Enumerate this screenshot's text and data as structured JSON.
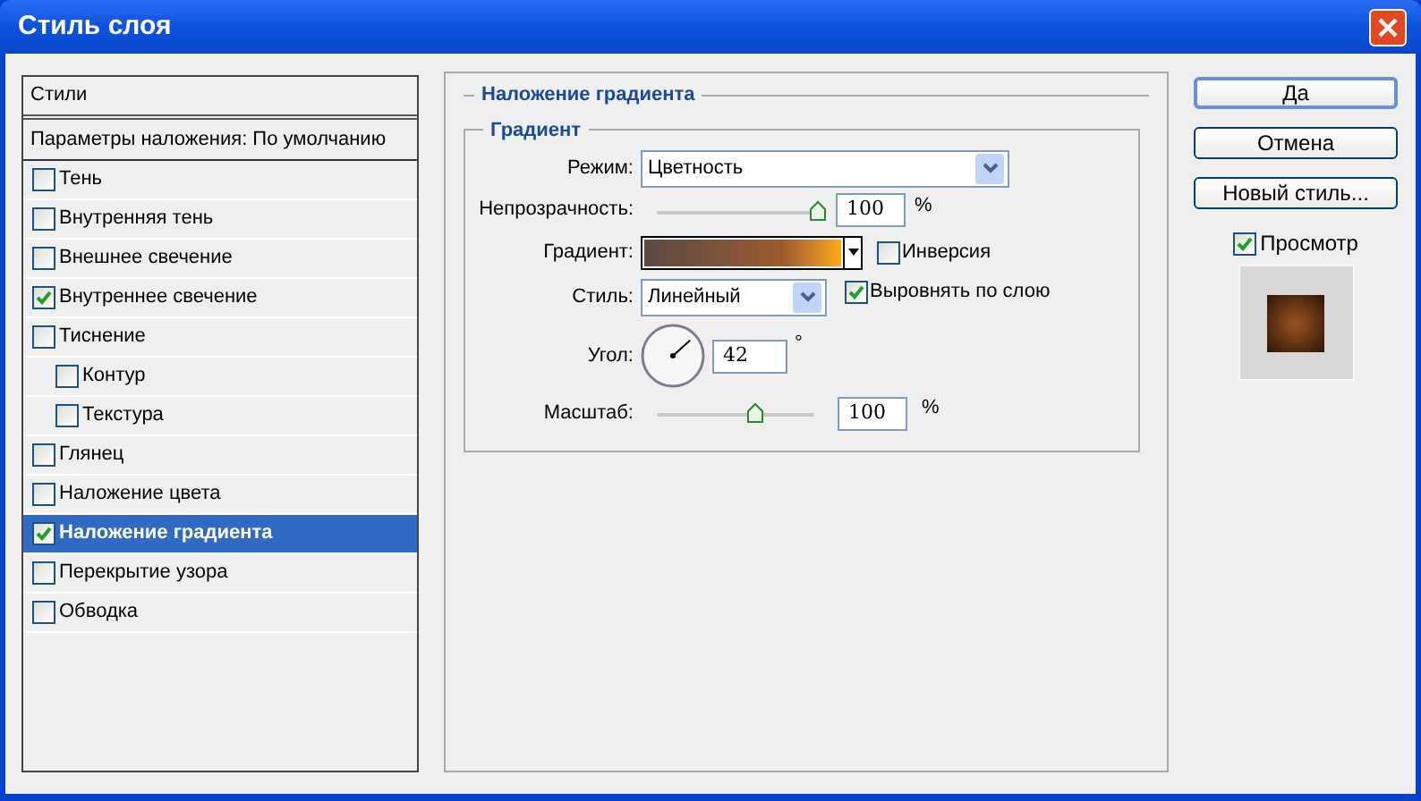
{
  "window": {
    "title": "Стиль слоя"
  },
  "styles_panel": {
    "header": "Стили",
    "blending_options": "Параметры наложения: По умолчанию",
    "items": [
      {
        "label": "Тень",
        "checked": false,
        "selected": false
      },
      {
        "label": "Внутренняя тень",
        "checked": false,
        "selected": false
      },
      {
        "label": "Внешнее свечение",
        "checked": false,
        "selected": false
      },
      {
        "label": "Внутреннее свечение",
        "checked": true,
        "selected": false
      },
      {
        "label": "Тиснение",
        "checked": false,
        "selected": false,
        "children": [
          {
            "label": "Контур",
            "checked": false,
            "selected": false
          },
          {
            "label": "Текстура",
            "checked": false,
            "selected": false
          }
        ]
      },
      {
        "label": "Глянец",
        "checked": false,
        "selected": false
      },
      {
        "label": "Наложение цвета",
        "checked": false,
        "selected": false
      },
      {
        "label": "Наложение градиента",
        "checked": true,
        "selected": true
      },
      {
        "label": "Перекрытие узора",
        "checked": false,
        "selected": false
      },
      {
        "label": "Обводка",
        "checked": false,
        "selected": false
      }
    ]
  },
  "section": {
    "title": "Наложение градиента",
    "group": "Градиент",
    "mode": {
      "label": "Режим:",
      "value": "Цветность"
    },
    "opacity": {
      "label": "Непрозрачность:",
      "level": 1.0,
      "value": "100",
      "unit": "%"
    },
    "gradient": {
      "label": "Градиент:",
      "reverse": {
        "label": "Инверсия",
        "checked": false
      }
    },
    "style": {
      "label": "Стиль:",
      "value": "Линейный",
      "align": {
        "label": "Выровнять по слою",
        "checked": true
      }
    },
    "angle": {
      "label": "Угол:",
      "value": "42",
      "unit": "°"
    },
    "scale": {
      "label": "Масштаб:",
      "level": 0.62,
      "value": "100",
      "unit": "%"
    }
  },
  "buttons": [
    {
      "label": "Да",
      "default": true
    },
    {
      "label": "Отмена",
      "default": false
    },
    {
      "label": "Новый стиль...",
      "default": false
    }
  ],
  "preview": {
    "label": "Просмотр",
    "checked": true
  }
}
